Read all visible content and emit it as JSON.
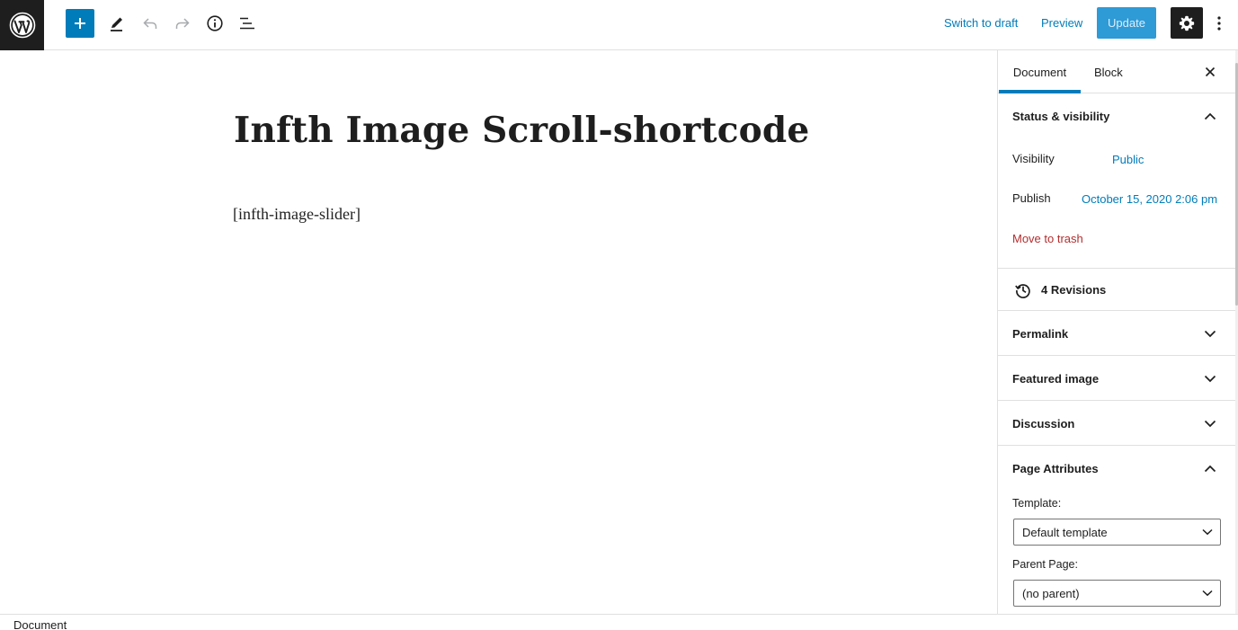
{
  "toolbar": {
    "switch_to_draft": "Switch to draft",
    "preview": "Preview",
    "update": "Update"
  },
  "editor": {
    "title": "Infth Image Scroll-shortcode",
    "shortcode": "[infth-image-slider]"
  },
  "sidebar": {
    "tabs": [
      "Document",
      "Block"
    ],
    "status": {
      "title": "Status & visibility",
      "visibility_label": "Visibility",
      "visibility_value": "Public",
      "publish_label": "Publish",
      "publish_value": "October 15, 2020 2:06 pm",
      "trash": "Move to trash"
    },
    "revisions": "4 Revisions",
    "permalink": "Permalink",
    "featured_image": "Featured image",
    "discussion": "Discussion",
    "page_attributes": {
      "title": "Page Attributes",
      "template_label": "Template:",
      "template_value": "Default template",
      "parent_label": "Parent Page:",
      "parent_value": "(no parent)"
    }
  },
  "footer": {
    "breadcrumb": "Document"
  },
  "colors": {
    "accent": "#007cba",
    "dark": "#1e1e1e",
    "danger": "#b32d2e",
    "update_button": "#2e9ad6"
  },
  "icons": [
    "wordpress-logo-icon",
    "plus-icon",
    "pencil-icon",
    "undo-icon",
    "redo-icon",
    "info-icon",
    "list-outline-icon",
    "gear-icon",
    "more-vertical-icon",
    "close-icon",
    "chevron-up-icon",
    "chevron-down-icon",
    "history-icon"
  ]
}
